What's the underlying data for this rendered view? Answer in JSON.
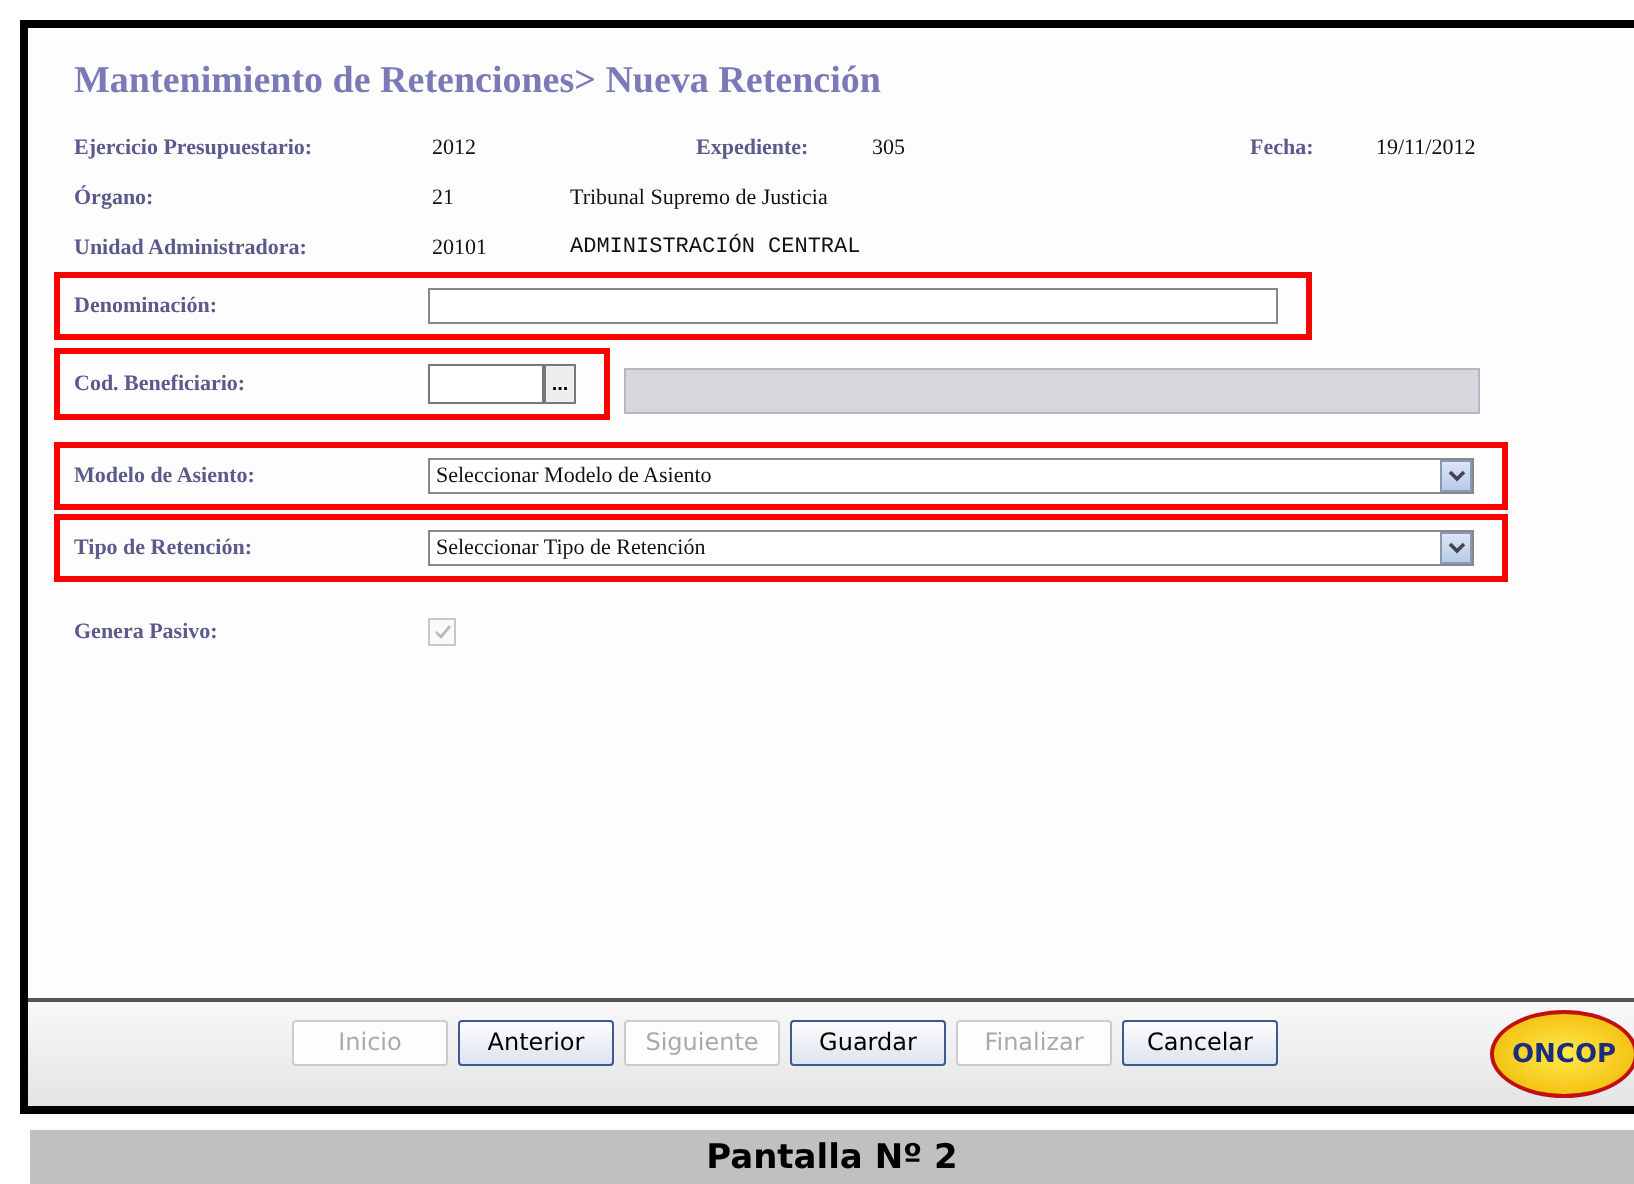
{
  "title": "Mantenimiento de Retenciones> Nueva Retención",
  "info": [
    {
      "label": "Ejercicio Presupuestario:",
      "value": "2012",
      "extra": [
        {
          "kind": "label",
          "text": "Expediente:"
        },
        {
          "kind": "value",
          "text": "305"
        },
        {
          "kind": "label",
          "text": "Fecha:"
        },
        {
          "kind": "value",
          "text": "19/11/2012"
        }
      ]
    },
    {
      "label": "Órgano:",
      "value": "21",
      "extra": [
        {
          "kind": "name",
          "text": "Tribunal Supremo de Justicia"
        }
      ]
    },
    {
      "label": "Unidad Administradora:",
      "value": "20101",
      "extra": [
        {
          "kind": "mono",
          "text": "ADMINISTRACIÓN CENTRAL"
        }
      ]
    }
  ],
  "form": [
    {
      "kind": "text",
      "label": "Denominación:",
      "highlighted": true
    },
    {
      "kind": "lookup",
      "label": "Cod. Beneficiario:",
      "button": "...",
      "highlighted": true
    },
    {
      "kind": "select",
      "label": "Modelo de Asiento:",
      "value": "Seleccionar Modelo de Asiento",
      "highlighted": true
    },
    {
      "kind": "select",
      "label": "Tipo de Retención:",
      "value": "Seleccionar Tipo de Retención",
      "highlighted": true
    },
    {
      "kind": "checkbox",
      "label": "Genera Pasivo:",
      "checked": true,
      "disabled": true,
      "highlighted": false
    }
  ],
  "buttons": [
    {
      "label": "Inicio",
      "disabled": true
    },
    {
      "label": "Anterior",
      "disabled": false
    },
    {
      "label": "Siguiente",
      "disabled": true
    },
    {
      "label": "Guardar",
      "disabled": false
    },
    {
      "label": "Finalizar",
      "disabled": true
    },
    {
      "label": "Cancelar",
      "disabled": false
    }
  ],
  "logo": "ONCOP",
  "caption": "Pantalla Nº 2"
}
